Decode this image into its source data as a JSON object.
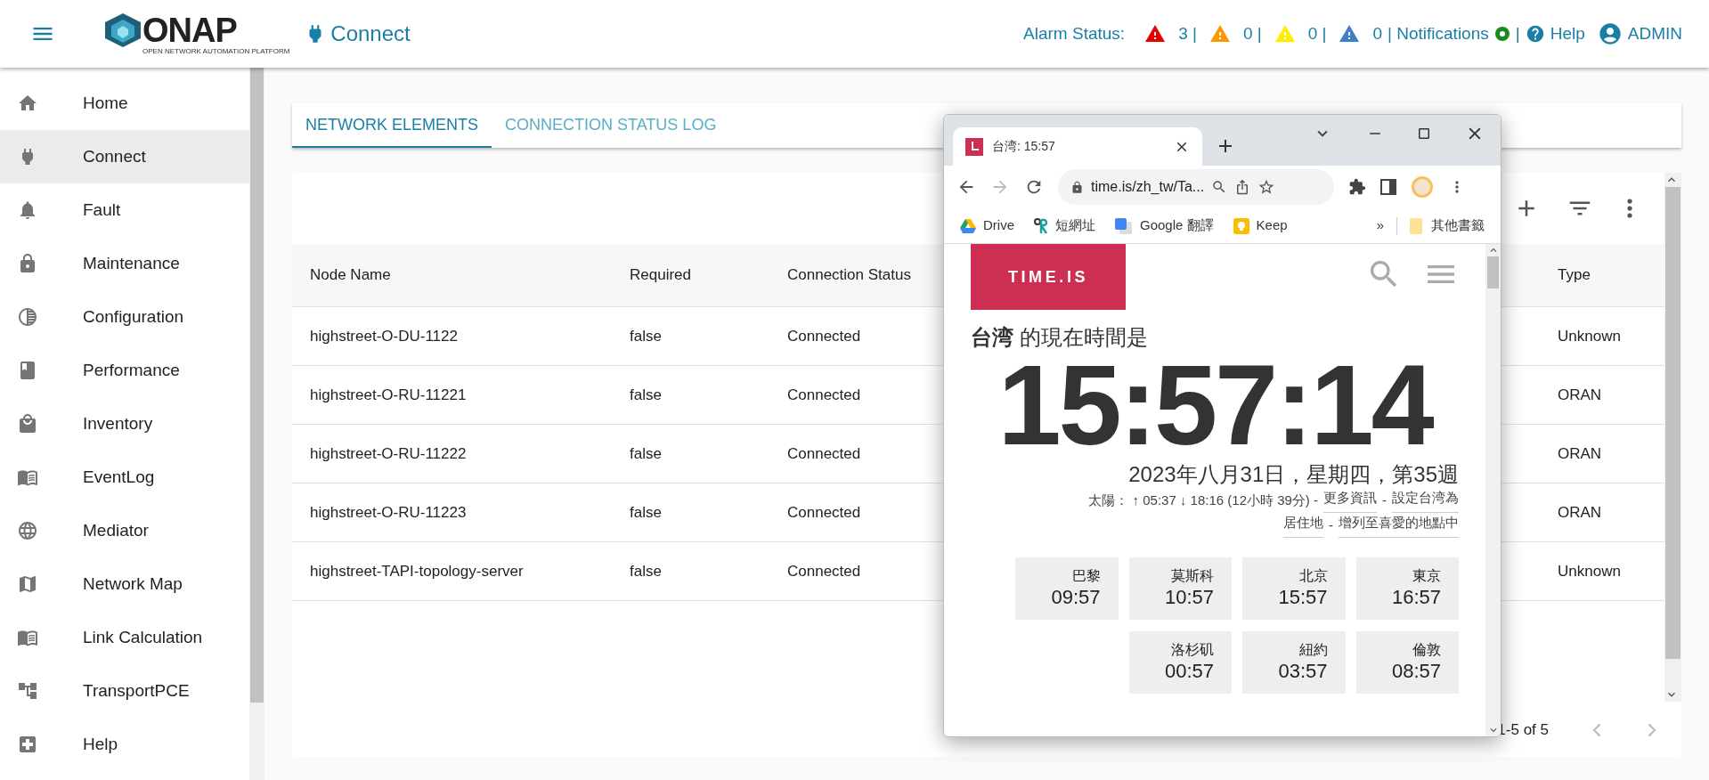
{
  "header": {
    "logo_text": "ONAP",
    "logo_subtitle": "OPEN NETWORK AUTOMATION PLATFORM",
    "page_title": "Connect",
    "alarm_label": "Alarm Status:",
    "alarms": [
      {
        "count": "3 |",
        "color": "#e60000"
      },
      {
        "count": "0 |",
        "color": "#ff9800"
      },
      {
        "count": "0 |",
        "color": "#ffee00"
      },
      {
        "count": "0",
        "color": "#3f7fc8"
      }
    ],
    "notifications": "| Notifications",
    "notification_separator": "|",
    "help": "Help",
    "user": "ADMIN"
  },
  "sidebar": {
    "items": [
      {
        "label": "Home",
        "selected": false
      },
      {
        "label": "Connect",
        "selected": true
      },
      {
        "label": "Fault",
        "selected": false
      },
      {
        "label": "Maintenance",
        "selected": false
      },
      {
        "label": "Configuration",
        "selected": false
      },
      {
        "label": "Performance",
        "selected": false
      },
      {
        "label": "Inventory",
        "selected": false
      },
      {
        "label": "EventLog",
        "selected": false
      },
      {
        "label": "Mediator",
        "selected": false
      },
      {
        "label": "Network Map",
        "selected": false
      },
      {
        "label": "Link Calculation",
        "selected": false
      },
      {
        "label": "TransportPCE",
        "selected": false
      },
      {
        "label": "Help",
        "selected": false
      }
    ]
  },
  "tabs": [
    {
      "label": "NETWORK ELEMENTS",
      "selected": true
    },
    {
      "label": "CONNECTION STATUS LOG",
      "selected": false
    }
  ],
  "table": {
    "columns": [
      "Node Name",
      "Required",
      "Connection Status",
      "Type"
    ],
    "rows": [
      {
        "node_name": "highstreet-O-DU-1122",
        "required": "false",
        "status": "Connected",
        "type": "Unknown"
      },
      {
        "node_name": "highstreet-O-RU-11221",
        "required": "false",
        "status": "Connected",
        "type": "ORAN"
      },
      {
        "node_name": "highstreet-O-RU-11222",
        "required": "false",
        "status": "Connected",
        "type": "ORAN"
      },
      {
        "node_name": "highstreet-O-RU-11223",
        "required": "false",
        "status": "Connected",
        "type": "ORAN"
      },
      {
        "node_name": "highstreet-TAPI-topology-server",
        "required": "false",
        "status": "Connected",
        "type": "Unknown"
      }
    ],
    "pagination": "1-5 of 5"
  },
  "browser": {
    "tab_title": "台湾: 15:57",
    "url": "time.is/zh_tw/Ta...",
    "bookmarks": [
      {
        "label": "Drive"
      },
      {
        "label": "短網址"
      },
      {
        "label": "Google 翻譯"
      },
      {
        "label": "Keep"
      }
    ],
    "more_bookmarks": "»",
    "other_bookmarks": "其他書籤",
    "page": {
      "logo": "TIME.IS",
      "heading": "**台湾** 的現在時間是",
      "clock": "15:57:14",
      "date": "2023年八月31日，星期四，第35週",
      "sun_lines": [
        [
          {
            "kind": "text",
            "text": "太陽： ↑ 05:37 ↓ 18:16 (12小時 39分) -"
          },
          {
            "kind": "link",
            "text": "更多資訊"
          },
          {
            "kind": "text",
            "text": "-"
          },
          {
            "kind": "link",
            "text": "設定台湾為"
          }
        ],
        [
          {
            "kind": "link",
            "text": "居住地"
          },
          {
            "kind": "text",
            "text": "-"
          },
          {
            "kind": "link",
            "text": "增列至喜愛的地點中"
          }
        ]
      ],
      "cities": [
        {
          "name": "巴黎",
          "time": "09:57"
        },
        {
          "name": "莫斯科",
          "time": "10:57"
        },
        {
          "name": "北京",
          "time": "15:57"
        },
        {
          "name": "東京",
          "time": "16:57"
        },
        {
          "name": "洛杉矶",
          "time": "00:57"
        },
        {
          "name": "紐約",
          "time": "03:57"
        },
        {
          "name": "倫敦",
          "time": "08:57"
        }
      ]
    }
  }
}
